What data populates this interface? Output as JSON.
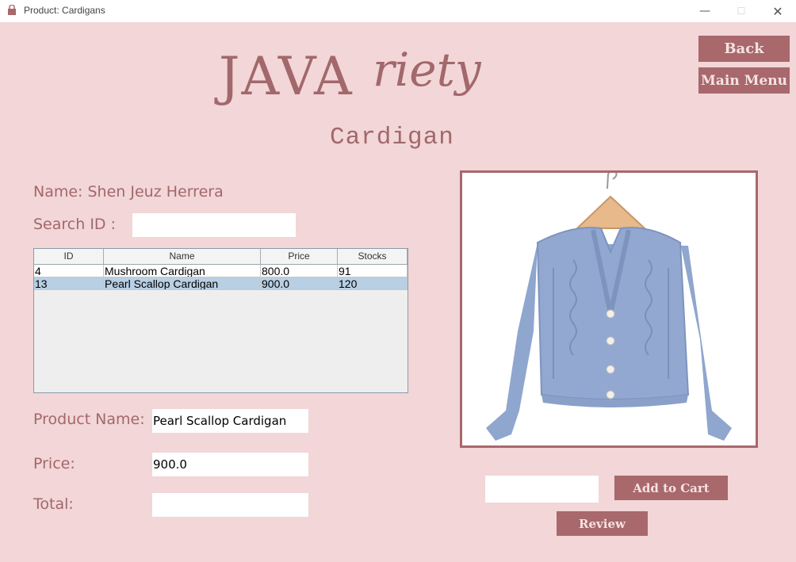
{
  "window": {
    "title": "Product: Cardigans"
  },
  "header": {
    "logo_part1": "JAVA",
    "logo_part2": "riety",
    "subtitle": "Cardigan",
    "back_label": "Back",
    "main_menu_label": "Main Menu"
  },
  "customer": {
    "name": "Name: Shen Jeuz Herrera"
  },
  "search": {
    "label": "Search ID :",
    "value": ""
  },
  "table": {
    "columns": [
      "ID",
      "Name",
      "Price",
      "Stocks"
    ],
    "rows": [
      [
        "4",
        "Mushroom Cardigan",
        "800.0",
        "91"
      ],
      [
        "13",
        "Pearl Scallop Cardigan",
        "900.0",
        "120"
      ]
    ],
    "selected_row": 1
  },
  "details": {
    "product_name_label": "Product Name:",
    "product_name_value": "Pearl Scallop Cardigan",
    "price_label": "Price:",
    "price_value": "900.0",
    "total_label": "Total:",
    "total_value": ""
  },
  "actions": {
    "quantity_value": "",
    "add_to_cart_label": "Add to Cart",
    "review_label": "Review"
  },
  "colors": {
    "background": "#f2d6d8",
    "accent": "#a8686c",
    "cardigan_blue": "#8fa6cf"
  },
  "icons": {
    "app": "shop-icon",
    "minimize": "minimize-icon",
    "maximize": "maximize-icon",
    "close": "close-icon"
  }
}
